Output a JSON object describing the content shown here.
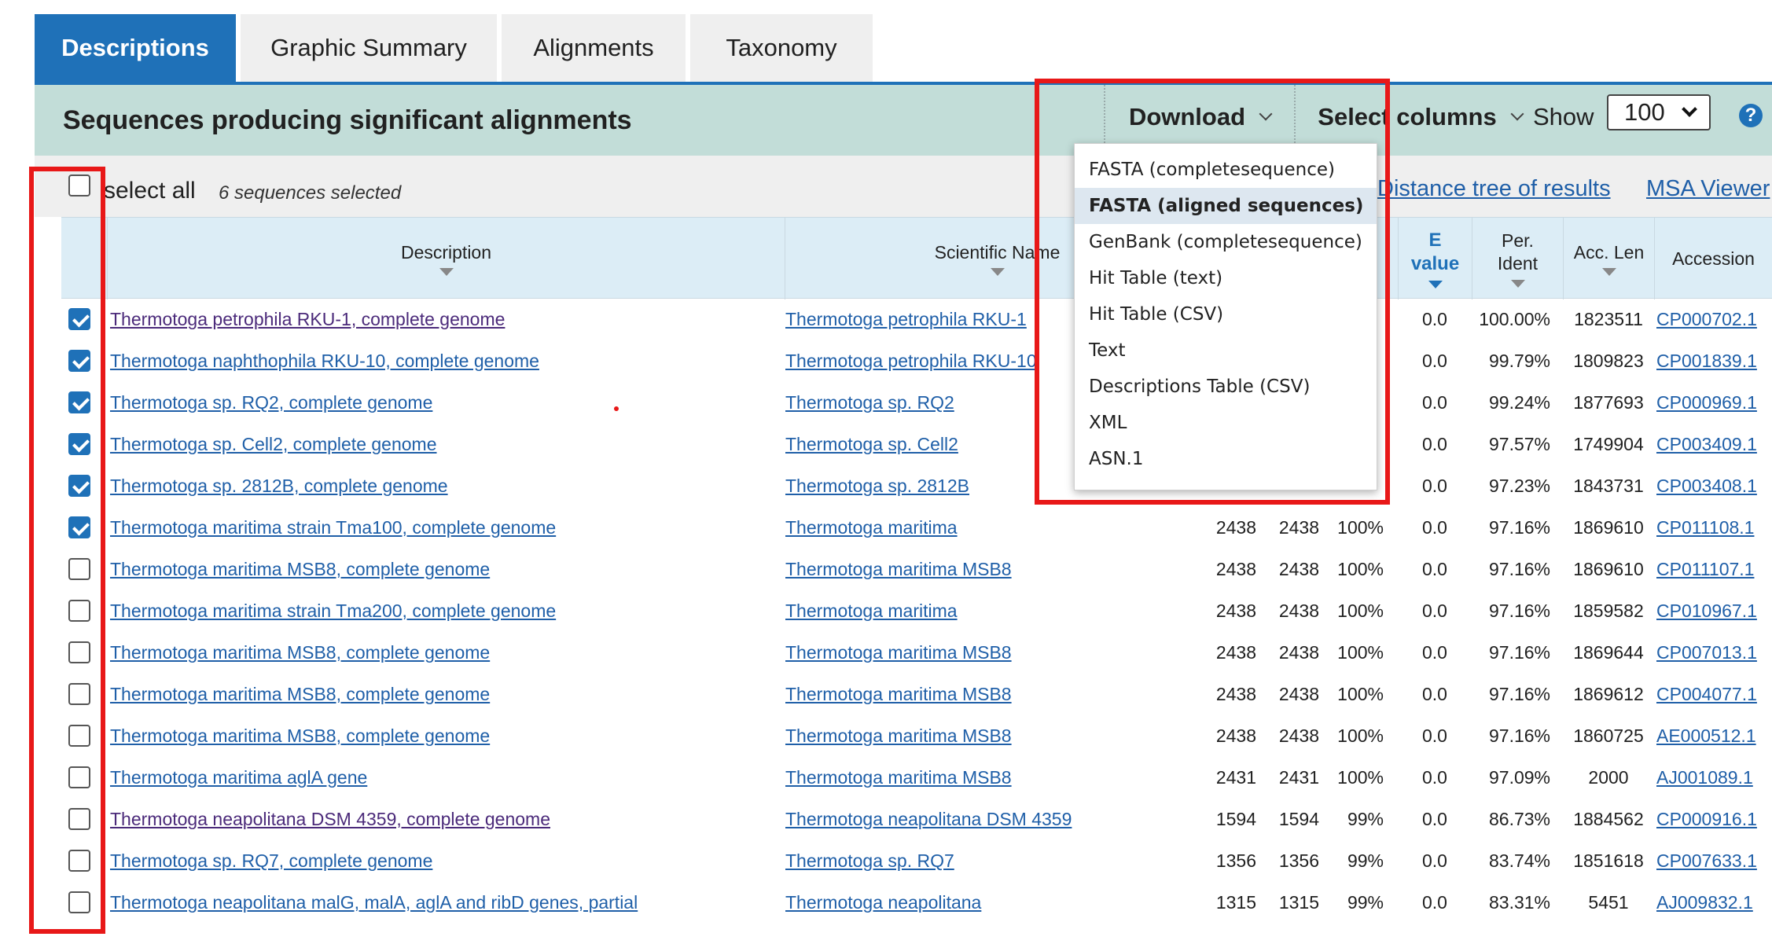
{
  "tabs": [
    {
      "label": "Descriptions",
      "active": true
    },
    {
      "label": "Graphic Summary",
      "active": false
    },
    {
      "label": "Alignments",
      "active": false
    },
    {
      "label": "Taxonomy",
      "active": false
    }
  ],
  "header": {
    "title": "Sequences producing significant alignments",
    "download_label": "Download",
    "select_columns_label": "Select columns",
    "show_label": "Show",
    "show_value": "100",
    "help_icon": "?"
  },
  "selection": {
    "select_all_label": "select all",
    "selected_count": "6 sequences selected",
    "links": [
      "Distance tree of results",
      "MSA Viewer"
    ]
  },
  "columns": {
    "description": "Description",
    "scientific_name": "Scientific Name",
    "e_value_line1": "E",
    "e_value_line2": "value",
    "per_ident_line1": "Per.",
    "per_ident_line2": "Ident",
    "acc_len": "Acc. Len",
    "accession": "Accession"
  },
  "rows": [
    {
      "checked": true,
      "description": "Thermotoga petrophila RKU-1, complete genome",
      "visited": true,
      "scientific_name": "Thermotoga petrophila RKU-1",
      "max_score": "",
      "total_score": "",
      "query_cover": "",
      "e_value": "0.0",
      "per_ident": "100.00%",
      "acc_len": "1823511",
      "accession": "CP000702.1"
    },
    {
      "checked": true,
      "description": "Thermotoga naphthophila RKU-10, complete genome",
      "visited": false,
      "scientific_name": "Thermotoga petrophila RKU-10",
      "max_score": "",
      "total_score": "",
      "query_cover": "",
      "e_value": "0.0",
      "per_ident": "99.79%",
      "acc_len": "1809823",
      "accession": "CP001839.1"
    },
    {
      "checked": true,
      "description": "Thermotoga sp. RQ2, complete genome",
      "visited": false,
      "scientific_name": "Thermotoga sp. RQ2",
      "max_score": "",
      "total_score": "",
      "query_cover": "",
      "e_value": "0.0",
      "per_ident": "99.24%",
      "acc_len": "1877693",
      "accession": "CP000969.1"
    },
    {
      "checked": true,
      "description": "Thermotoga sp. Cell2, complete genome",
      "visited": false,
      "scientific_name": "Thermotoga sp. Cell2",
      "max_score": "",
      "total_score": "",
      "query_cover": "",
      "e_value": "0.0",
      "per_ident": "97.57%",
      "acc_len": "1749904",
      "accession": "CP003409.1"
    },
    {
      "checked": true,
      "description": "Thermotoga sp. 2812B, complete genome",
      "visited": false,
      "scientific_name": "Thermotoga sp. 2812B",
      "max_score": "",
      "total_score": "",
      "query_cover": "",
      "e_value": "0.0",
      "per_ident": "97.23%",
      "acc_len": "1843731",
      "accession": "CP003408.1"
    },
    {
      "checked": true,
      "description": "Thermotoga maritima strain Tma100, complete genome",
      "visited": false,
      "scientific_name": "Thermotoga maritima",
      "max_score": "2438",
      "total_score": "2438",
      "query_cover": "100%",
      "e_value": "0.0",
      "per_ident": "97.16%",
      "acc_len": "1869610",
      "accession": "CP011108.1"
    },
    {
      "checked": false,
      "description": "Thermotoga maritima MSB8, complete genome",
      "visited": false,
      "scientific_name": "Thermotoga maritima MSB8",
      "max_score": "2438",
      "total_score": "2438",
      "query_cover": "100%",
      "e_value": "0.0",
      "per_ident": "97.16%",
      "acc_len": "1869610",
      "accession": "CP011107.1"
    },
    {
      "checked": false,
      "description": "Thermotoga maritima strain Tma200, complete genome",
      "visited": false,
      "scientific_name": "Thermotoga maritima",
      "max_score": "2438",
      "total_score": "2438",
      "query_cover": "100%",
      "e_value": "0.0",
      "per_ident": "97.16%",
      "acc_len": "1859582",
      "accession": "CP010967.1"
    },
    {
      "checked": false,
      "description": "Thermotoga maritima MSB8, complete genome",
      "visited": false,
      "scientific_name": "Thermotoga maritima MSB8",
      "max_score": "2438",
      "total_score": "2438",
      "query_cover": "100%",
      "e_value": "0.0",
      "per_ident": "97.16%",
      "acc_len": "1869644",
      "accession": "CP007013.1"
    },
    {
      "checked": false,
      "description": "Thermotoga maritima MSB8, complete genome",
      "visited": false,
      "scientific_name": "Thermotoga maritima MSB8",
      "max_score": "2438",
      "total_score": "2438",
      "query_cover": "100%",
      "e_value": "0.0",
      "per_ident": "97.16%",
      "acc_len": "1869612",
      "accession": "CP004077.1"
    },
    {
      "checked": false,
      "description": "Thermotoga maritima MSB8, complete genome",
      "visited": false,
      "scientific_name": "Thermotoga maritima MSB8",
      "max_score": "2438",
      "total_score": "2438",
      "query_cover": "100%",
      "e_value": "0.0",
      "per_ident": "97.16%",
      "acc_len": "1860725",
      "accession": "AE000512.1"
    },
    {
      "checked": false,
      "description": "Thermotoga maritima aglA gene",
      "visited": false,
      "scientific_name": "Thermotoga maritima MSB8",
      "max_score": "2431",
      "total_score": "2431",
      "query_cover": "100%",
      "e_value": "0.0",
      "per_ident": "97.09%",
      "acc_len": "2000",
      "accession": "AJ001089.1"
    },
    {
      "checked": false,
      "description": "Thermotoga neapolitana DSM 4359, complete genome",
      "visited": true,
      "scientific_name": "Thermotoga neapolitana DSM 4359",
      "max_score": "1594",
      "total_score": "1594",
      "query_cover": "99%",
      "e_value": "0.0",
      "per_ident": "86.73%",
      "acc_len": "1884562",
      "accession": "CP000916.1"
    },
    {
      "checked": false,
      "description": "Thermotoga sp. RQ7, complete genome",
      "visited": false,
      "scientific_name": "Thermotoga sp. RQ7",
      "max_score": "1356",
      "total_score": "1356",
      "query_cover": "99%",
      "e_value": "0.0",
      "per_ident": "83.74%",
      "acc_len": "1851618",
      "accession": "CP007633.1"
    },
    {
      "checked": false,
      "description": "Thermotoga neapolitana malG, malA, aglA and ribD genes, partial",
      "visited": false,
      "scientific_name": "Thermotoga neapolitana",
      "max_score": "1315",
      "total_score": "1315",
      "query_cover": "99%",
      "e_value": "0.0",
      "per_ident": "83.31%",
      "acc_len": "5451",
      "accession": "AJ009832.1"
    }
  ],
  "download_menu": {
    "items": [
      {
        "label": "FASTA (completesequence)",
        "highlighted": false
      },
      {
        "label": "FASTA (aligned sequences)",
        "highlighted": true
      },
      {
        "label": "GenBank (completesequence)",
        "highlighted": false
      },
      {
        "label": "Hit Table (text)",
        "highlighted": false
      },
      {
        "label": "Hit Table (CSV)",
        "highlighted": false
      },
      {
        "label": "Text",
        "highlighted": false
      },
      {
        "label": "Descriptions Table (CSV)",
        "highlighted": false
      },
      {
        "label": "XML",
        "highlighted": false
      },
      {
        "label": "ASN.1",
        "highlighted": false
      }
    ]
  },
  "colors": {
    "accent": "#1f71b8",
    "header_band": "#c2ddd8",
    "table_header": "#dcedf6",
    "link": "#1f5fa8",
    "visited_link": "#4b2a7a",
    "annotation_red": "#e81818"
  }
}
